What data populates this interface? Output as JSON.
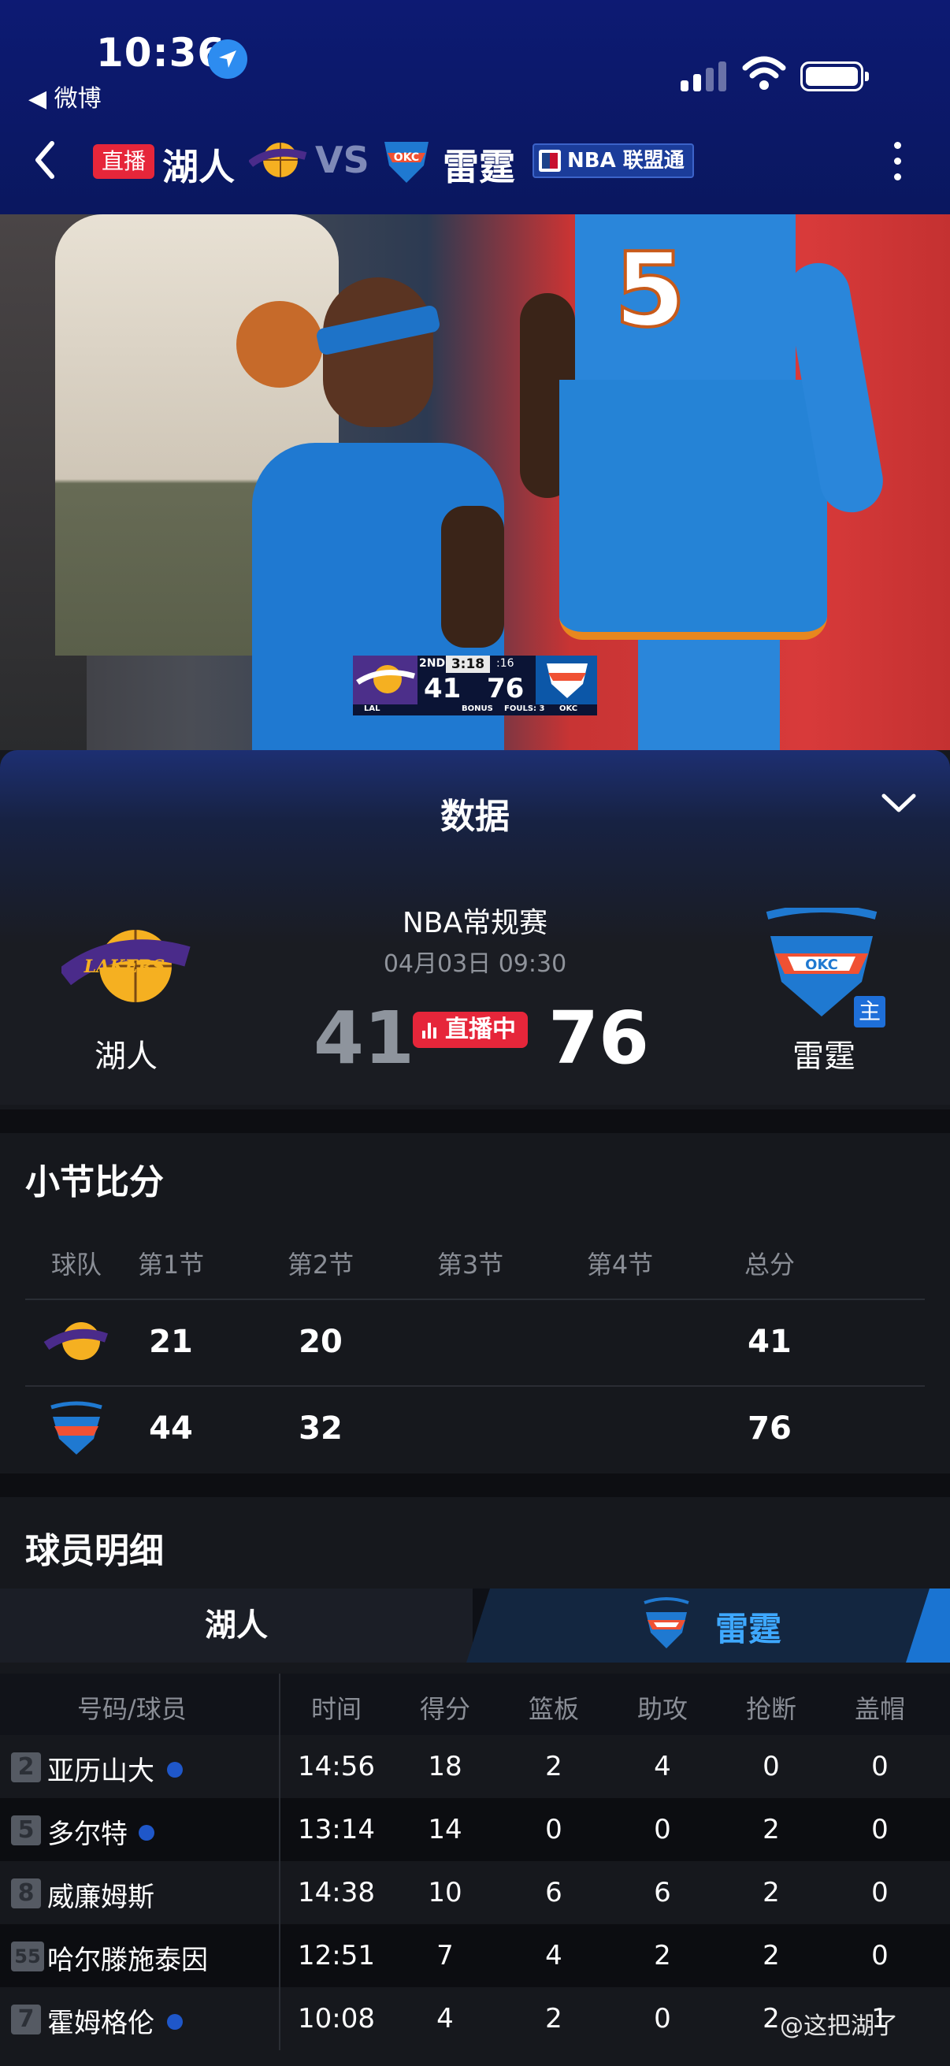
{
  "status_bar": {
    "time": "10:36",
    "back_app": "◀ 微博"
  },
  "nav": {
    "live_badge": "直播",
    "team_a": "湖人",
    "vs": "VS",
    "team_b": "雷霆",
    "pass": "NBA 联盟通"
  },
  "scorebug": {
    "quarter": "2ND",
    "clock": "3:18",
    "shot_clock": ":16",
    "score_a": "41",
    "score_b": "76",
    "abbr_a": "LAL",
    "abbr_b": "OKC",
    "bonus": "BONUS",
    "fouls": "FOULS: 3",
    "jersey_number": "5"
  },
  "panel": {
    "title": "数据",
    "league": "NBA常规赛",
    "datetime": "04月03日 09:30",
    "score_a": "41",
    "score_b": "76",
    "live_label": "直播中",
    "team_a": "湖人",
    "team_b": "雷霆",
    "home_badge": "主"
  },
  "quarters": {
    "title": "小节比分",
    "headers": [
      "球队",
      "第1节",
      "第2节",
      "第3节",
      "第4节",
      "总分"
    ],
    "rows": [
      {
        "team": "lakers",
        "q1": "21",
        "q2": "20",
        "q3": "",
        "q4": "",
        "total": "41"
      },
      {
        "team": "thunder",
        "q1": "44",
        "q2": "32",
        "q3": "",
        "q4": "",
        "total": "76"
      }
    ]
  },
  "players": {
    "title": "球员明细",
    "tab_a": "湖人",
    "tab_b": "雷霆",
    "headers": [
      "号码/球员",
      "时间",
      "得分",
      "篮板",
      "助攻",
      "抢断",
      "盖帽"
    ],
    "rows": [
      {
        "no": "2",
        "name": "亚历山大",
        "time": "14:56",
        "pts": "18",
        "reb": "2",
        "ast": "4",
        "stl": "0",
        "blk": "0"
      },
      {
        "no": "5",
        "name": "多尔特",
        "time": "13:14",
        "pts": "14",
        "reb": "0",
        "ast": "0",
        "stl": "2",
        "blk": "0"
      },
      {
        "no": "8",
        "name": "威廉姆斯",
        "time": "14:38",
        "pts": "10",
        "reb": "6",
        "ast": "6",
        "stl": "2",
        "blk": "0"
      },
      {
        "no": "55",
        "name": "哈尔滕施泰因",
        "time": "12:51",
        "pts": "7",
        "reb": "4",
        "ast": "2",
        "stl": "2",
        "blk": "0"
      },
      {
        "no": "7",
        "name": "霍姆格伦",
        "time": "10:08",
        "pts": "4",
        "reb": "2",
        "ast": "0",
        "stl": "2",
        "blk": "1"
      }
    ]
  },
  "watermark": "@这把湖了",
  "colors": {
    "live_red": "#e6263a",
    "thunder_blue": "#1f79d1",
    "header_navy": "#0d1a73"
  }
}
